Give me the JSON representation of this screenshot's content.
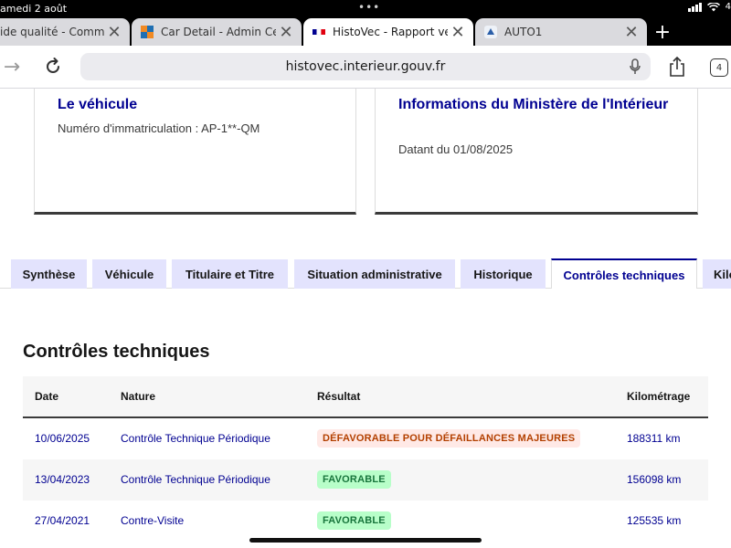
{
  "status_bar": {
    "time": "amedi 2 août",
    "battery": "4"
  },
  "browser": {
    "tabs": [
      {
        "label": "ide qualité - Comment",
        "favicon": "page-icon"
      },
      {
        "label": "Car Detail - Admin Center",
        "favicon": "grid-logo-icon"
      },
      {
        "label": "HistoVec - Rapport vendeur",
        "favicon": "french-flag-icon"
      },
      {
        "label": "AUTO1",
        "favicon": "auto1-logo-icon"
      }
    ],
    "url": "histovec.interieur.gouv.fr",
    "tab_count": "4"
  },
  "cards": {
    "vehicle": {
      "title": "Le véhicule",
      "text": "Numéro d'immatriculation : AP-1**-QM"
    },
    "ministry": {
      "title": "Informations du Ministère de l'Intérieur",
      "text": "Datant du 01/08/2025"
    }
  },
  "section_tabs": [
    "Synthèse",
    "Véhicule",
    "Titulaire et Titre",
    "Situation administrative",
    "Historique",
    "Contrôles techniques",
    "Kilo"
  ],
  "technical_controls": {
    "title": "Contrôles techniques",
    "columns": [
      "Date",
      "Nature",
      "Résultat",
      "Kilométrage"
    ],
    "rows": [
      {
        "date": "10/06/2025",
        "nature": "Contrôle Technique Périodique",
        "result": "DÉFAVORABLE POUR DÉFAILLANCES MAJEURES",
        "status": "bad",
        "km": "188311 km"
      },
      {
        "date": "13/04/2023",
        "nature": "Contrôle Technique Périodique",
        "result": "FAVORABLE",
        "status": "good",
        "km": "156098 km"
      },
      {
        "date": "27/04/2021",
        "nature": "Contre-Visite",
        "result": "FAVORABLE",
        "status": "good",
        "km": "125535 km"
      }
    ]
  },
  "colors": {
    "brand_blue": "#000091",
    "tab_inactive": "#e3e3fd",
    "bad_bg": "#ffe9e6",
    "bad_text": "#b34000",
    "good_bg": "#b8fec9",
    "good_text": "#18753c"
  }
}
